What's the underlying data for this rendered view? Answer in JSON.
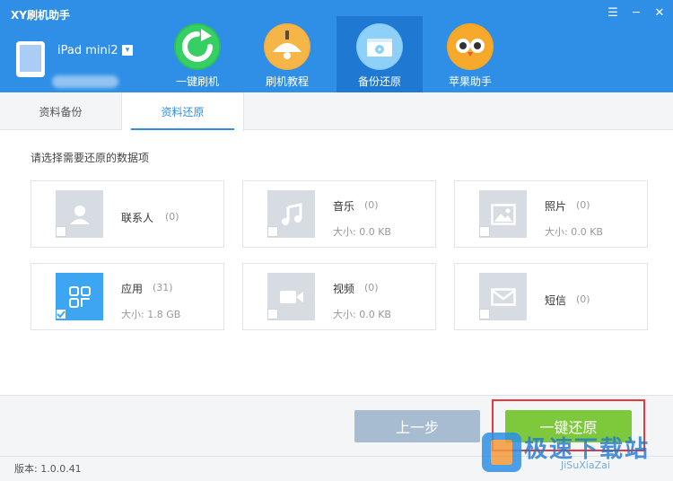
{
  "app": {
    "title": "XY刷机助手"
  },
  "window_controls": {
    "menu": "☰",
    "minimize": "─",
    "close": "✕"
  },
  "device": {
    "name": "iPad mini2",
    "dropdown": "▾"
  },
  "nav": [
    {
      "label": "一键刷机",
      "icon": "refresh-icon",
      "color": "#2ec05a",
      "active": false
    },
    {
      "label": "刷机教程",
      "icon": "lamp-icon",
      "color": "#f2a93b",
      "active": false
    },
    {
      "label": "备份还原",
      "icon": "disk-icon",
      "color": "#7cc8f7",
      "active": true
    },
    {
      "label": "苹果助手",
      "icon": "owl-icon",
      "color": "#f6a623",
      "active": false
    }
  ],
  "tabs": [
    {
      "label": "资料备份",
      "active": false
    },
    {
      "label": "资料还原",
      "active": true
    }
  ],
  "section": {
    "label": "请选择需要还原的数据项"
  },
  "items": [
    {
      "name": "联系人",
      "count": "(0)",
      "size": "",
      "icon": "contact-icon",
      "checked": false
    },
    {
      "name": "音乐",
      "count": "(0)",
      "size": "大小: 0.0 KB",
      "icon": "music-icon",
      "checked": false
    },
    {
      "name": "照片",
      "count": "(0)",
      "size": "大小: 0.0 KB",
      "icon": "photo-icon",
      "checked": false
    },
    {
      "name": "应用",
      "count": "(31)",
      "size": "大小: 1.8 GB",
      "icon": "apps-icon",
      "checked": true
    },
    {
      "name": "视频",
      "count": "(0)",
      "size": "大小: 0.0 KB",
      "icon": "video-icon",
      "checked": false
    },
    {
      "name": "短信",
      "count": "(0)",
      "size": "",
      "icon": "message-icon",
      "checked": false
    }
  ],
  "buttons": {
    "prev": "上一步",
    "restore": "一键还原"
  },
  "status": {
    "version": "版本: 1.0.0.41"
  },
  "watermark": {
    "text": "极速下载站",
    "sub": "JiSuXiaZai"
  },
  "colors": {
    "header": "#2f8fe6",
    "accent": "#3da6f2",
    "go": "#7ec83c",
    "highlight": "#e8383d"
  }
}
